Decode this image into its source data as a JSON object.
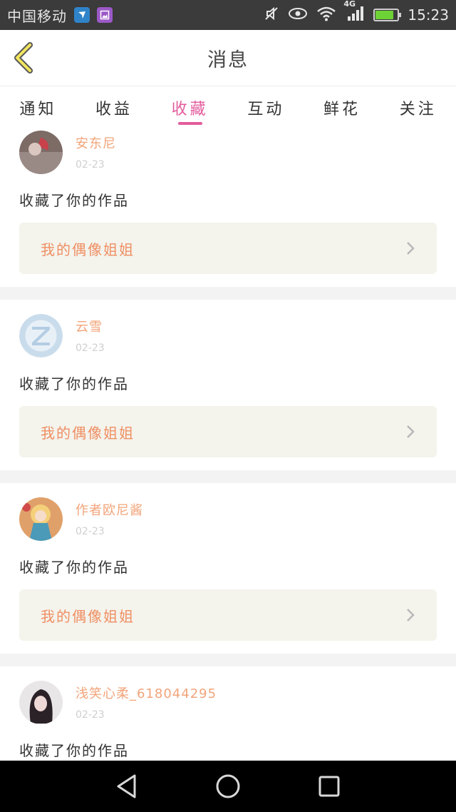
{
  "status_bar": {
    "carrier": "中国移动",
    "time": "15:23",
    "network": "4G",
    "battery_level": 0.9
  },
  "header": {
    "title": "消息"
  },
  "tabs": [
    {
      "label": "通知",
      "active": false
    },
    {
      "label": "收益",
      "active": false
    },
    {
      "label": "收藏",
      "active": true
    },
    {
      "label": "互动",
      "active": false
    },
    {
      "label": "鲜花",
      "active": false
    },
    {
      "label": "关注",
      "active": false
    }
  ],
  "messages": [
    {
      "username": "安东尼",
      "date": "02-23",
      "action": "收藏了你的作品",
      "work": "我的偶像姐姐"
    },
    {
      "username": "云雪",
      "date": "02-23",
      "action": "收藏了你的作品",
      "work": "我的偶像姐姐"
    },
    {
      "username": "作者欧尼酱",
      "date": "02-23",
      "action": "收藏了你的作品",
      "work": "我的偶像姐姐"
    },
    {
      "username": "浅笑心柔_618044295",
      "date": "02-23",
      "action": "收藏了你的作品",
      "work": ""
    }
  ],
  "colors": {
    "accent": "#e35c9c",
    "username": "#f2a47a",
    "work_title": "#ef8f63"
  }
}
